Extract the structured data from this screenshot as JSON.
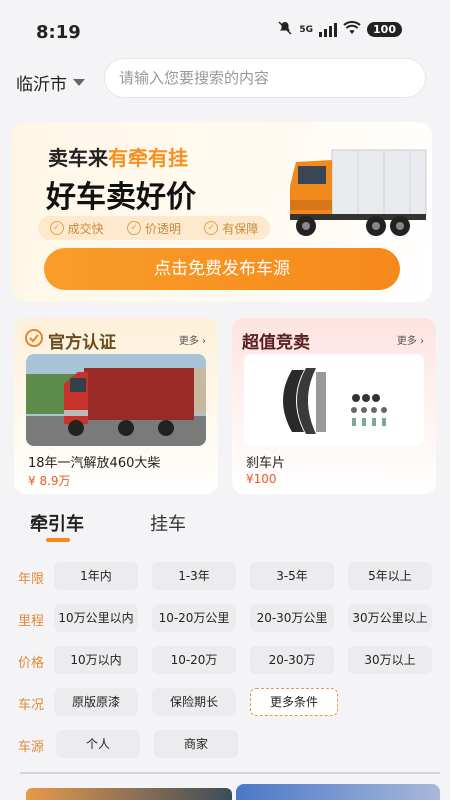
{
  "status": {
    "time": "8:19",
    "network": "5G",
    "battery": "100"
  },
  "header": {
    "city": "临沂市",
    "search_placeholder": "请输入您要搜索的内容"
  },
  "banner": {
    "line1_prefix": "卖车来",
    "line1_highlight": "有牵有挂",
    "line2": "好车卖好价",
    "tags": [
      "成交快",
      "价透明",
      "有保障"
    ],
    "button": "点击免费发布车源"
  },
  "cards": {
    "official": {
      "title": "官方认证",
      "more": "更多 ›",
      "item_name": "18年一汽解放460大柴",
      "item_price": "¥ 8.9万"
    },
    "auction": {
      "title": "超值竞卖",
      "more": "更多 ›",
      "item_name": "刹车片",
      "item_price": "¥100"
    }
  },
  "type_tabs": {
    "active": "牵引车",
    "inactive": "挂车"
  },
  "filters": [
    {
      "label": "年限",
      "options": [
        "1年内",
        "1-3年",
        "3-5年",
        "5年以上"
      ]
    },
    {
      "label": "里程",
      "options": [
        "10万公里以内",
        "10-20万公里",
        "20-30万公里",
        "30万公里以上"
      ]
    },
    {
      "label": "价格",
      "options": [
        "10万以内",
        "10-20万",
        "20-30万",
        "30万以上"
      ]
    },
    {
      "label": "车况",
      "options": [
        "原版原漆",
        "保险期长",
        "更多条件"
      ]
    },
    {
      "label": "车源",
      "options": [
        "个人",
        "商家"
      ]
    }
  ],
  "colors": {
    "accent": "#f6891a",
    "price": "#f05a22",
    "filter_label": "#e08a3c"
  }
}
